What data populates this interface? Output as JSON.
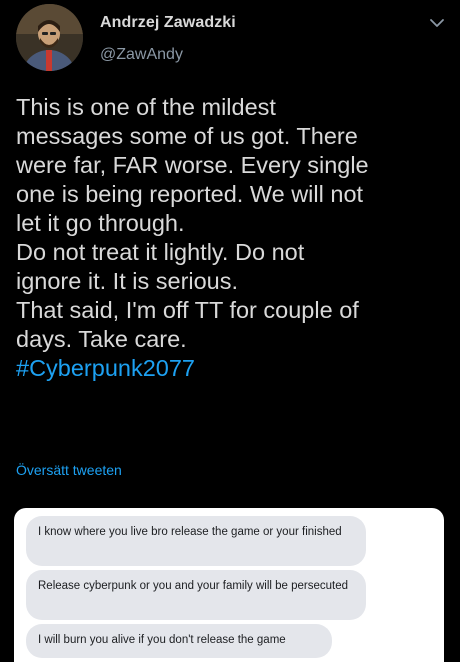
{
  "author": {
    "name": "Andrzej Zawadzki",
    "handle": "@ZawAndy",
    "avatar_icon": "profile-photo"
  },
  "menu_icon": "chevron-down-icon",
  "tweet": {
    "lines": [
      "This is one of the mildest",
      "messages some of us got. There",
      "were far, FAR worse. Every single",
      "one is being reported. We will not",
      "let it go through.",
      "Do not treat it lightly. Do not",
      "ignore it. It is serious.",
      "That said, I'm off TT for couple of",
      "days. Take care."
    ],
    "hashtag": "#Cyberpunk2077"
  },
  "translate_label": "Översätt tweeten",
  "media": {
    "messages": [
      "I know where you live bro release the game or your finished",
      "Release cyberpunk or you and your family will be persecuted",
      "I will burn you alive if you don't release the game"
    ]
  },
  "colors": {
    "background": "#000000",
    "text": "#d9d9d9",
    "muted": "#8b98a5",
    "link": "#1da1f2",
    "bubble": "#e4e6eb"
  }
}
